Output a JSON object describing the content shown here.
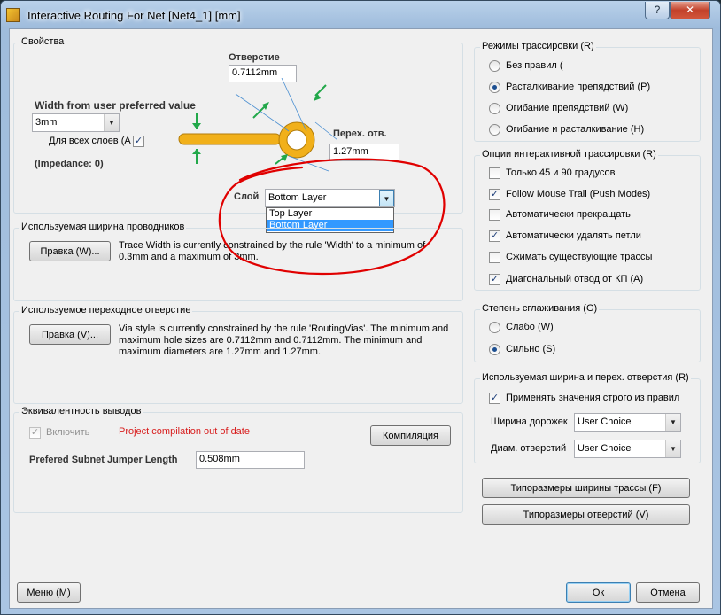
{
  "window": {
    "title": "Interactive Routing For Net [Net4_1] [mm]",
    "help": "?",
    "close": "✕"
  },
  "props": {
    "title": "Свойства",
    "hole_label": "Отверстие",
    "hole_value": "0.7112mm",
    "width_label": "Width from user preferred value",
    "width_value": "3mm",
    "all_layers": "Для всех слоев (A",
    "impedance": "(Impedance: 0)",
    "via_label": "Перех. отв.",
    "via_value": "1.27mm",
    "layer_label": "Слой",
    "layer_value": "Bottom Layer",
    "layer_options": [
      "Top Layer",
      "Bottom Layer"
    ]
  },
  "trace_width": {
    "title": "Используемая ширина проводников",
    "edit": "Правка (W)...",
    "desc": "Trace Width is currently constrained by the rule 'Width' to a minimum of 0.3mm and a maximum of 3mm."
  },
  "via": {
    "title": "Используемое переходное отверстие",
    "edit": "Правка (V)...",
    "desc": "Via style is currently constrained by the rule 'RoutingVias'. The minimum and maximum hole sizes are 0.7112mm and 0.7112mm. The minimum and maximum diameters are 1.27mm and 1.27mm."
  },
  "equiv": {
    "title": "Эквивалентность выводов",
    "enable": "Включить",
    "warning": "Project compilation out of date",
    "compile": "Компиляция",
    "jumper_label": "Prefered Subnet Jumper Length",
    "jumper_value": "0.508mm"
  },
  "modes": {
    "title": "Режимы трассировки (R)",
    "items": [
      {
        "label": "Без правил (",
        "selected": false
      },
      {
        "label": "Расталкивание препядствий (P)",
        "selected": true
      },
      {
        "label": "Огибание препядствий (W)",
        "selected": false
      },
      {
        "label": "Огибание и расталкивание (H)",
        "selected": false
      }
    ]
  },
  "options": {
    "title": "Опции интерактивной трассировки (R)",
    "items": [
      {
        "label": "Только 45 и 90 градусов",
        "checked": false
      },
      {
        "label": "Follow Mouse Trail (Push Modes)",
        "checked": true
      },
      {
        "label": "Автоматически прекращать",
        "checked": false
      },
      {
        "label": "Автоматически удалять петли",
        "checked": true
      },
      {
        "label": "Сжимать существующие трассы",
        "checked": false
      },
      {
        "label": "Диагональный отвод от КП (A)",
        "checked": true
      }
    ]
  },
  "smooth": {
    "title": "Степень сглаживания (G)",
    "items": [
      {
        "label": "Слабо (W)",
        "selected": false
      },
      {
        "label": "Сильно (S)",
        "selected": true
      }
    ]
  },
  "usedwidth": {
    "title": "Используемая ширина и перех. отверстия (R)",
    "strict": "Применять значения строго из правил",
    "track_label": "Ширина дорожек",
    "track_value": "User Choice",
    "hole_label": "Диам. отверстий",
    "hole_value": "User Choice"
  },
  "buttons": {
    "track_sizes": "Типоразмеры ширины трассы (F)",
    "hole_sizes": "Типоразмеры отверстий (V)",
    "menu": "Меню (M)",
    "ok": "Ок",
    "cancel": "Отмена"
  },
  "colors": {
    "trace": "#f1b01a",
    "trace_stroke": "#b37d0a",
    "arrow": "#22a84a",
    "annotation": "#e00000"
  }
}
